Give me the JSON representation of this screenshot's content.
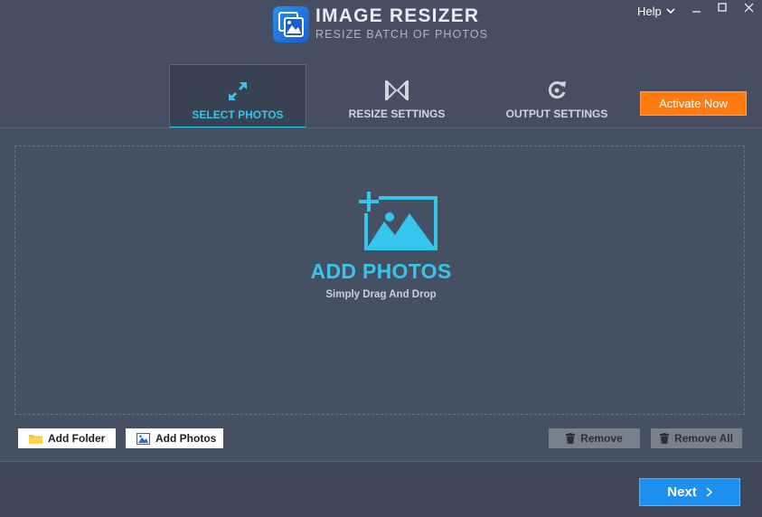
{
  "app": {
    "title": "IMAGE RESIZER",
    "subtitle": "RESIZE BATCH OF PHOTOS"
  },
  "window": {
    "help_label": "Help"
  },
  "tabs": [
    {
      "label": "SELECT PHOTOS",
      "icon": "expand-arrows-icon",
      "active": true
    },
    {
      "label": "RESIZE SETTINGS",
      "icon": "resize-arrows-icon",
      "active": false
    },
    {
      "label": "OUTPUT SETTINGS",
      "icon": "refresh-icon",
      "active": false
    }
  ],
  "activate_label": "Activate Now",
  "dropzone": {
    "title": "ADD PHOTOS",
    "subtitle": "Simply Drag And Drop"
  },
  "actions": {
    "add_folder": "Add Folder",
    "add_photos": "Add Photos",
    "remove": "Remove",
    "remove_all": "Remove All"
  },
  "footer": {
    "next_label": "Next"
  },
  "colors": {
    "background": "#465063",
    "accent": "#35c6ee",
    "activate": "#ff7a0f",
    "next": "#1e90f0"
  }
}
